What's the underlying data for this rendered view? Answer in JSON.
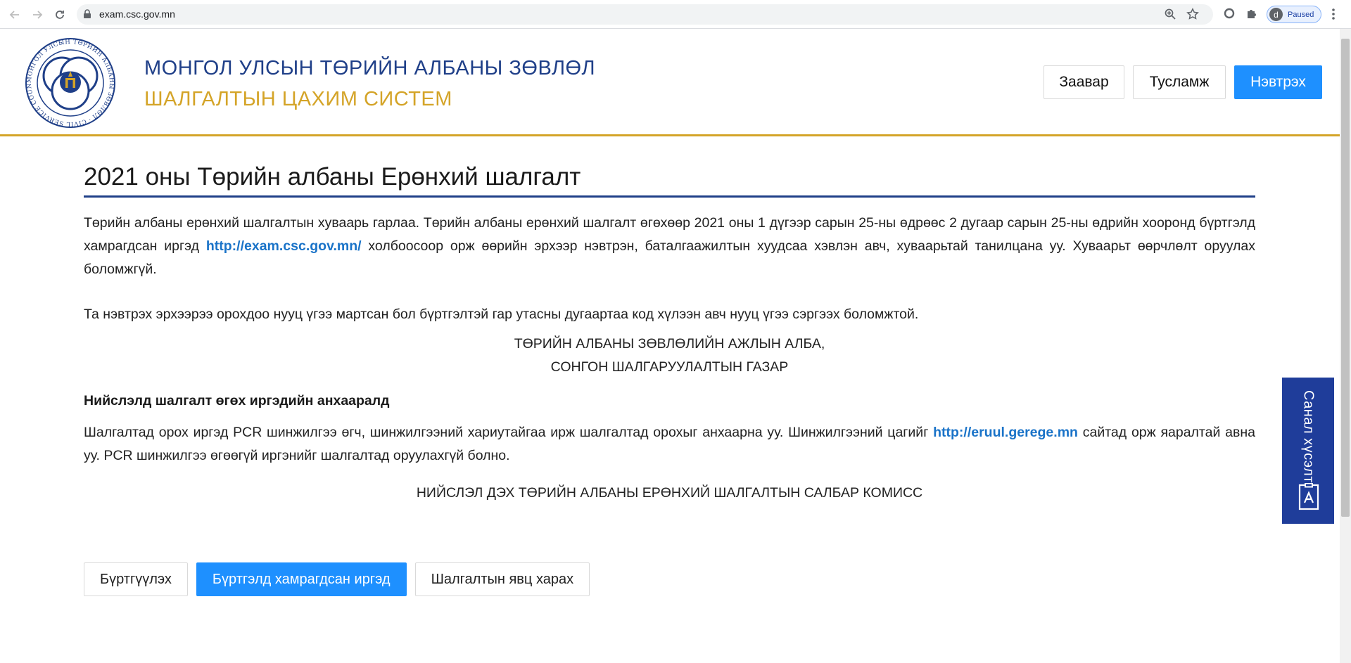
{
  "browser": {
    "url": "exam.csc.gov.mn",
    "profile_initial": "d",
    "profile_status": "Paused"
  },
  "header": {
    "logo_text": "МОНГОЛ УЛСЫН ТӨРИЙН АЛБАНЫ ЗӨВЛӨЛ · CIVIL SERVICE COUNCIL OF MONGOLIA",
    "title_line1": "МОНГОЛ УЛСЫН ТӨРИЙН АЛБАНЫ ЗӨВЛӨЛ",
    "title_line2": "ШАЛГАЛТЫН ЦАХИМ СИСТЕМ",
    "buttons": {
      "guide": "Заавар",
      "help": "Тусламж",
      "login": "Нэвтрэх"
    },
    "colors": {
      "navy": "#1f3f88",
      "gold": "#d4a428",
      "primary": "#1e90ff"
    }
  },
  "main": {
    "title": "2021 оны Төрийн албаны Ерөнхий шалгалт",
    "p1_before": "Төрийн албаны ерөнхий шалгалтын хуваарь гарлаа. Төрийн албаны ерөнхий шалгалт өгөхөөр 2021 оны 1 дүгээр сарын 25-ны өдрөөс 2 дугаар сарын 25-ны өдрийн хооронд бүртгэлд хамрагдсан иргэд ",
    "p1_link": "http://exam.csc.gov.mn/",
    "p1_after": " холбоосоор орж өөрийн эрхээр нэвтрэн, баталгаажилтын хуудсаа хэвлэн авч, хуваарьтай танилцана уу. Хуваарьт өөрчлөлт оруулах боломжгүй.",
    "p2": "Та нэвтрэх эрхээрээ орохдоо нууц үгээ мартсан бол бүртгэлтэй гар утасны дугаартаа код хүлээн авч нууц үгээ сэргээх боломжтой.",
    "sig1_line1": "ТӨРИЙН АЛБАНЫ ЗӨВЛӨЛИЙН АЖЛЫН АЛБА,",
    "sig1_line2": "СОНГОН ШАЛГАРУУЛАЛТЫН ГАЗАР",
    "notice_heading": "Нийслэлд шалгалт өгөх иргэдийн анхааралд",
    "p3_before": "Шалгалтад орох иргэд PCR шинжилгээ өгч, шинжилгээний хариутайгаа ирж шалгалтад орохыг анхаарна уу. Шинжилгээний цагийг ",
    "p3_link": "http://eruul.gerege.mn",
    "p3_after": " сайтад орж яаралтай авна уу. PCR шинжилгээ өгөөгүй иргэнийг шалгалтад оруулахгүй болно.",
    "sig2": "НИЙСЛЭЛ ДЭХ ТӨРИЙН АЛБАНЫ ЕРӨНХИЙ ШАЛГАЛТЫН САЛБАР КОМИСС"
  },
  "actions": {
    "register": "Бүртгүүлэх",
    "registered_citizens": "Бүртгэлд хамрагдсан иргэд",
    "exam_progress": "Шалгалтын явц харах"
  },
  "feedback": {
    "label": "Санал хүсэлт"
  }
}
